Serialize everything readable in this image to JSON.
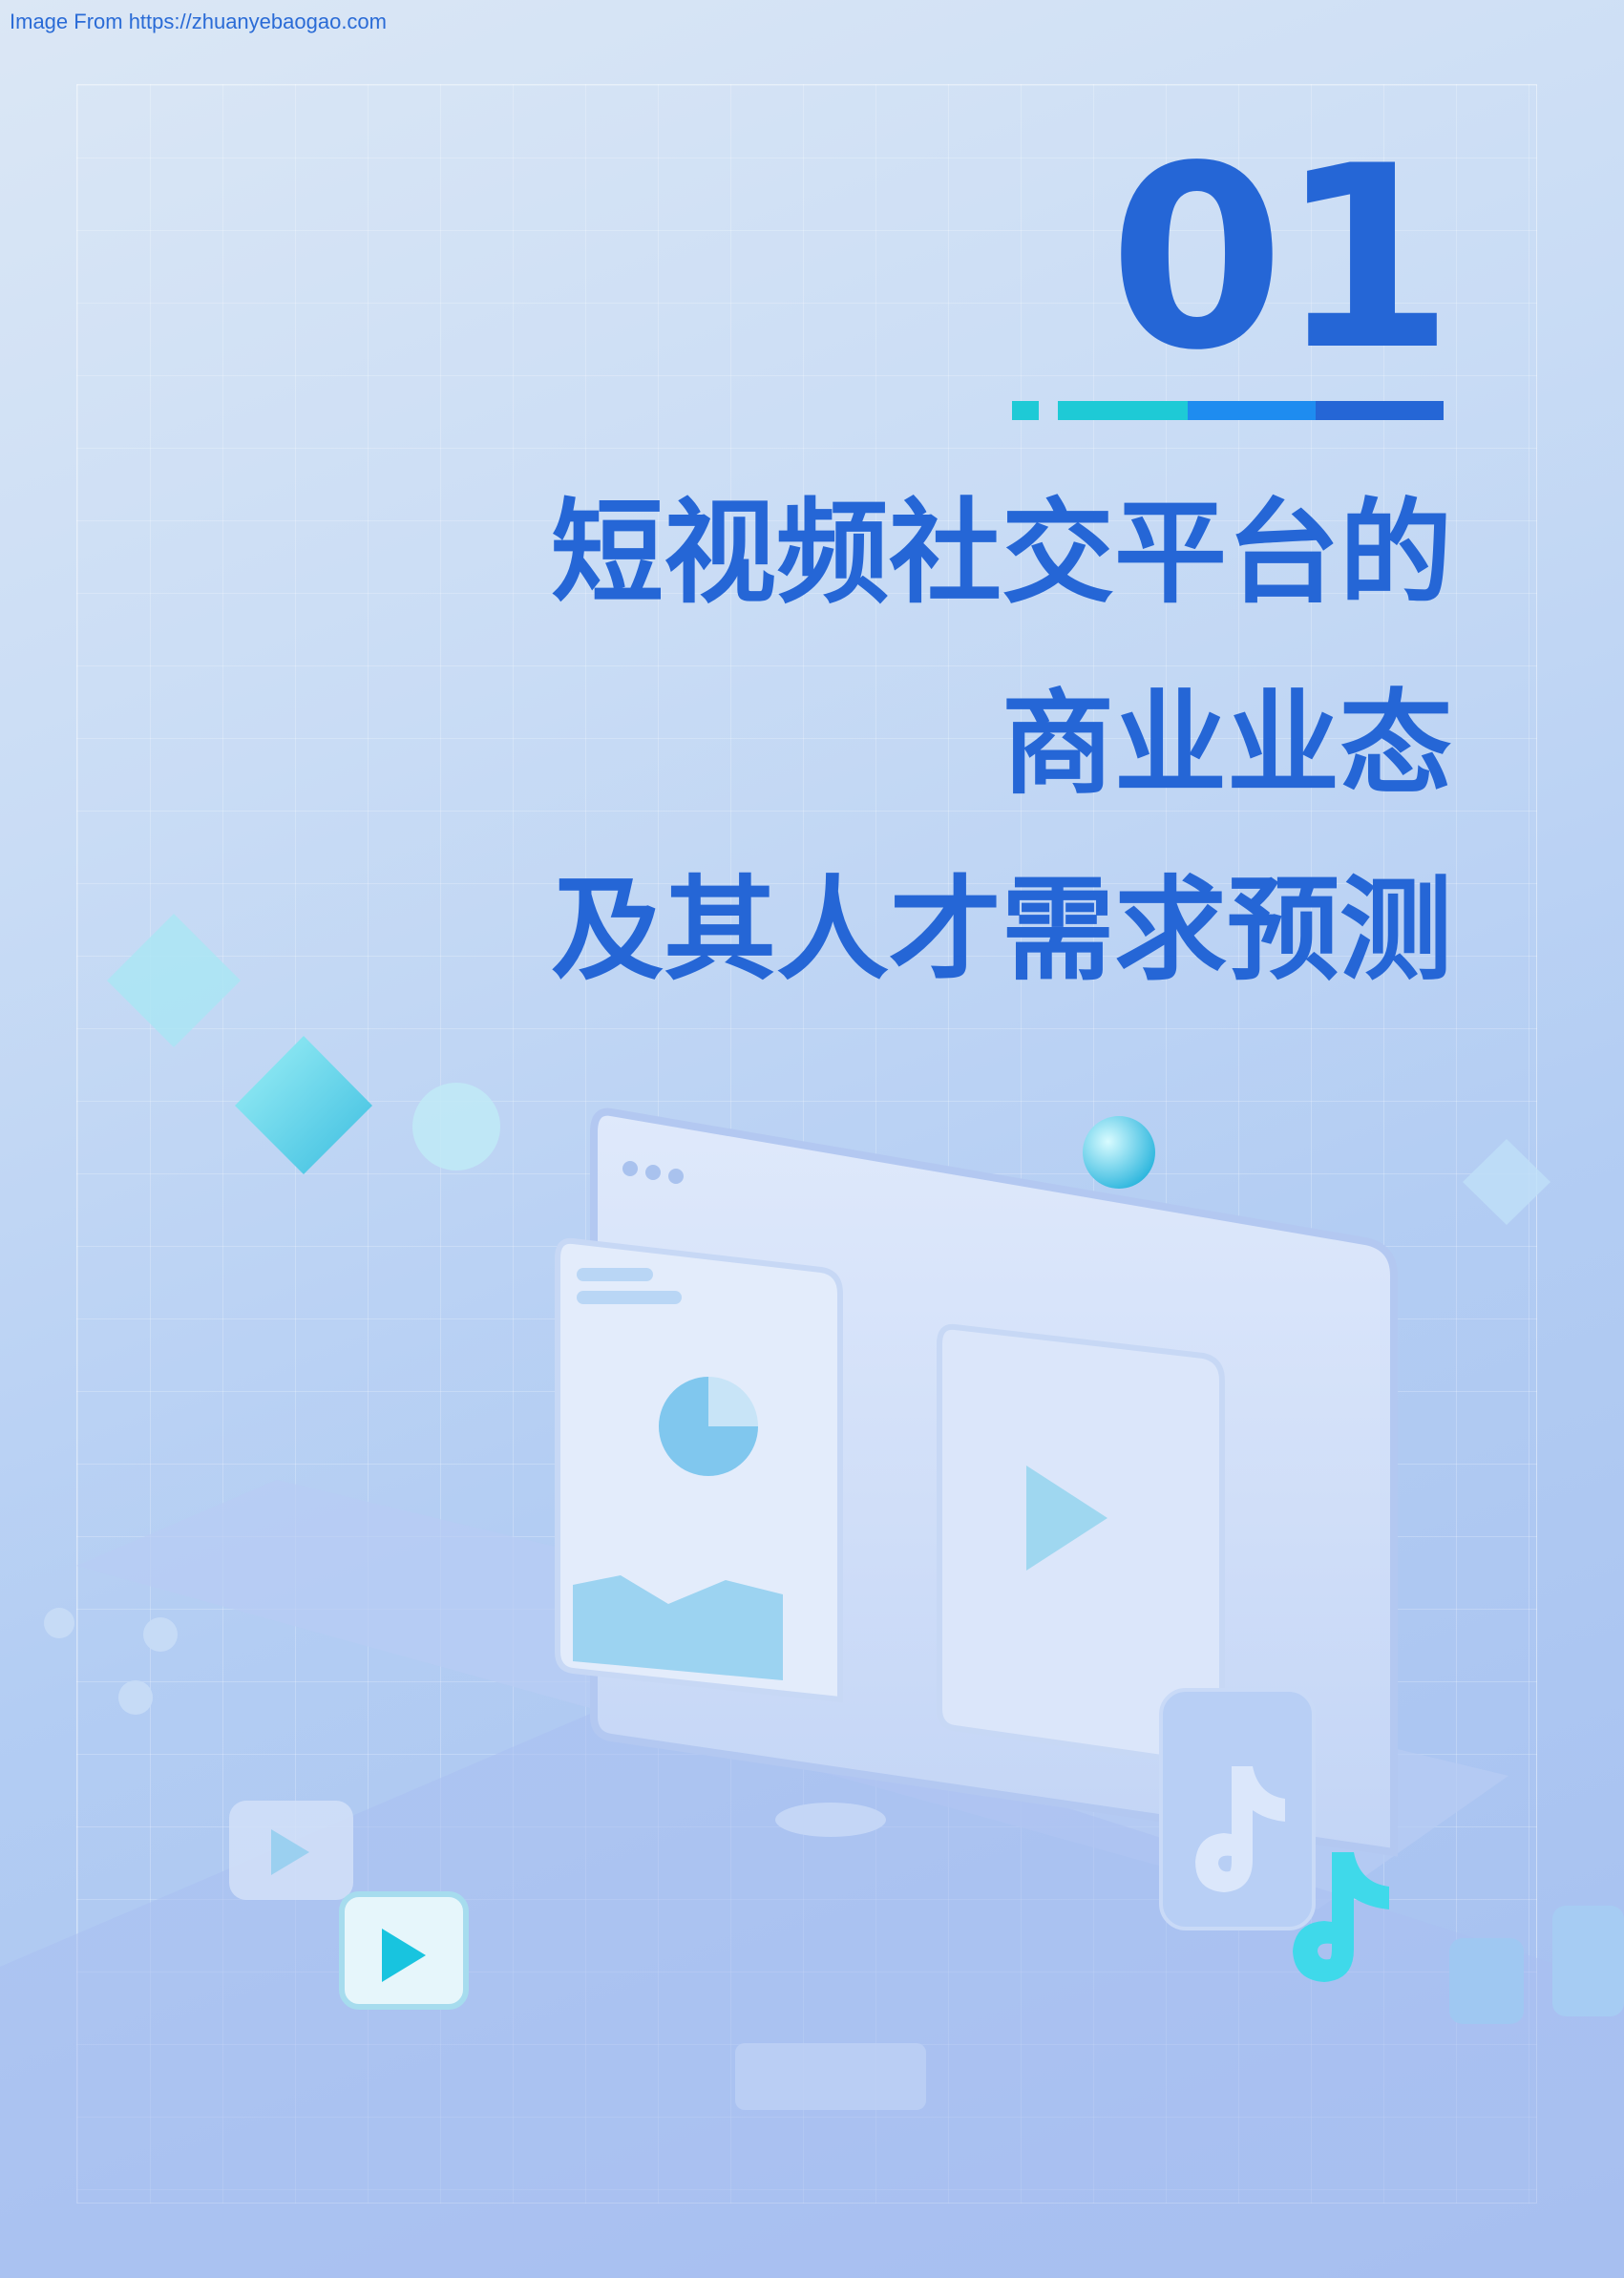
{
  "watermark": "Image From https://zhuanyebaogao.com",
  "chapter": {
    "number": "01"
  },
  "title": {
    "line1": "短视频社交平台的",
    "line2": "商业业态",
    "line3": "及其人才需求预测"
  },
  "colors": {
    "primary": "#2566d6",
    "cyan": "#1ecad6",
    "mid_blue": "#1e8cf0"
  },
  "icons": [
    "play-icon",
    "tiktok-icon",
    "pie-chart-icon",
    "area-chart-icon"
  ]
}
